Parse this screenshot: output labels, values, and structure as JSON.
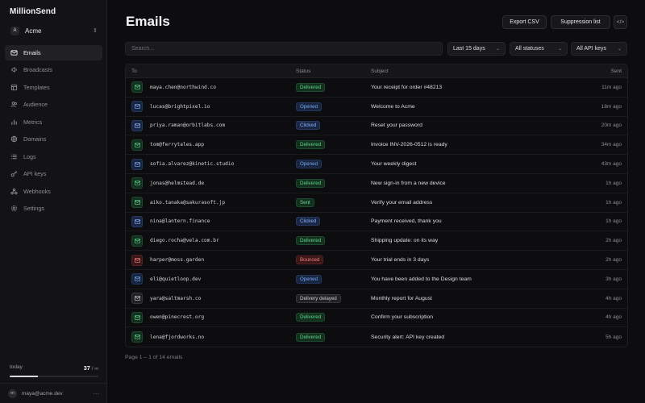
{
  "brand": "MillionSend",
  "team": {
    "initial": "A",
    "name": "Acme"
  },
  "nav": [
    {
      "label": "Emails",
      "icon": "mail-icon",
      "active": true
    },
    {
      "label": "Broadcasts",
      "icon": "broadcast-icon",
      "active": false
    },
    {
      "label": "Templates",
      "icon": "template-icon",
      "active": false
    },
    {
      "label": "Audience",
      "icon": "users-icon",
      "active": false
    },
    {
      "label": "Metrics",
      "icon": "chart-icon",
      "active": false
    },
    {
      "label": "Domains",
      "icon": "globe-icon",
      "active": false
    },
    {
      "label": "Logs",
      "icon": "list-icon",
      "active": false
    },
    {
      "label": "API keys",
      "icon": "key-icon",
      "active": false
    },
    {
      "label": "Webhooks",
      "icon": "webhook-icon",
      "active": false
    },
    {
      "label": "Settings",
      "icon": "gear-icon",
      "active": false
    }
  ],
  "usage": {
    "label": "today",
    "count": "37",
    "limit": "∞",
    "fill": 0.32
  },
  "user": {
    "initial": "m",
    "email": "maya@acme.dev"
  },
  "page": {
    "title": "Emails",
    "export_label": "Export CSV",
    "suppression_label": "Suppression list",
    "code_label": "</>"
  },
  "filters": {
    "search_placeholder": "Search...",
    "date_range": "Last 15 days",
    "status": "All statuses",
    "api_keys": "All API keys"
  },
  "table": {
    "headers": {
      "to": "To",
      "status": "Status",
      "subject": "Subject",
      "sent": "Sent"
    },
    "rows": [
      {
        "to": "maya.chen@northwind.co",
        "status": "Delivered",
        "subject": "Your receipt for order #48213",
        "sent": "11m ago"
      },
      {
        "to": "lucas@brightpixel.io",
        "status": "Opened",
        "subject": "Welcome to Acme",
        "sent": "18m ago"
      },
      {
        "to": "priya.raman@orbitlabs.com",
        "status": "Clicked",
        "subject": "Reset your password",
        "sent": "20m ago"
      },
      {
        "to": "tom@ferrytales.app",
        "status": "Delivered",
        "subject": "Invoice INV-2026-0512 is ready",
        "sent": "34m ago"
      },
      {
        "to": "sofia.alvarez@kinetic.studio",
        "status": "Opened",
        "subject": "Your weekly digest",
        "sent": "43m ago"
      },
      {
        "to": "jonas@helmstead.de",
        "status": "Delivered",
        "subject": "New sign-in from a new device",
        "sent": "1h ago"
      },
      {
        "to": "aiko.tanaka@sakurasoft.jp",
        "status": "Sent",
        "subject": "Verify your email address",
        "sent": "1h ago"
      },
      {
        "to": "nina@lantern.finance",
        "status": "Clicked",
        "subject": "Payment received, thank you",
        "sent": "1h ago"
      },
      {
        "to": "diego.rocha@vela.com.br",
        "status": "Delivered",
        "subject": "Shipping update: on its way",
        "sent": "2h ago"
      },
      {
        "to": "harper@moss.garden",
        "status": "Bounced",
        "subject": "Your trial ends in 3 days",
        "sent": "2h ago"
      },
      {
        "to": "eli@quietloop.dev",
        "status": "Opened",
        "subject": "You have been added to the Design team",
        "sent": "3h ago"
      },
      {
        "to": "yara@saltmarsh.co",
        "status": "Delivery delayed",
        "subject": "Monthly report for August",
        "sent": "4h ago"
      },
      {
        "to": "owen@pinecrest.org",
        "status": "Delivered",
        "subject": "Confirm your subscription",
        "sent": "4h ago"
      },
      {
        "to": "lena@fjordworks.no",
        "status": "Delivered",
        "subject": "Security alert: API key created",
        "sent": "5h ago"
      }
    ]
  },
  "status_colors": {
    "Delivered": {
      "bg": "#12301d",
      "fg": "#5fd28a",
      "border": "#1d4a2c"
    },
    "Opened": {
      "bg": "#172540",
      "fg": "#7aa6ef",
      "border": "#22375d"
    },
    "Clicked": {
      "bg": "#1b2645",
      "fg": "#8ab0f5",
      "border": "#273a66"
    },
    "Sent": {
      "bg": "#13301f",
      "fg": "#6fd596",
      "border": "#1e4a2e"
    },
    "Bounced": {
      "bg": "#3a1616",
      "fg": "#f08080",
      "border": "#5a2222"
    },
    "Delivery delayed": {
      "bg": "#222226",
      "fg": "#c8c8ce",
      "border": "#36363c"
    }
  },
  "footer": "Page 1 – 1 of 14 emails"
}
